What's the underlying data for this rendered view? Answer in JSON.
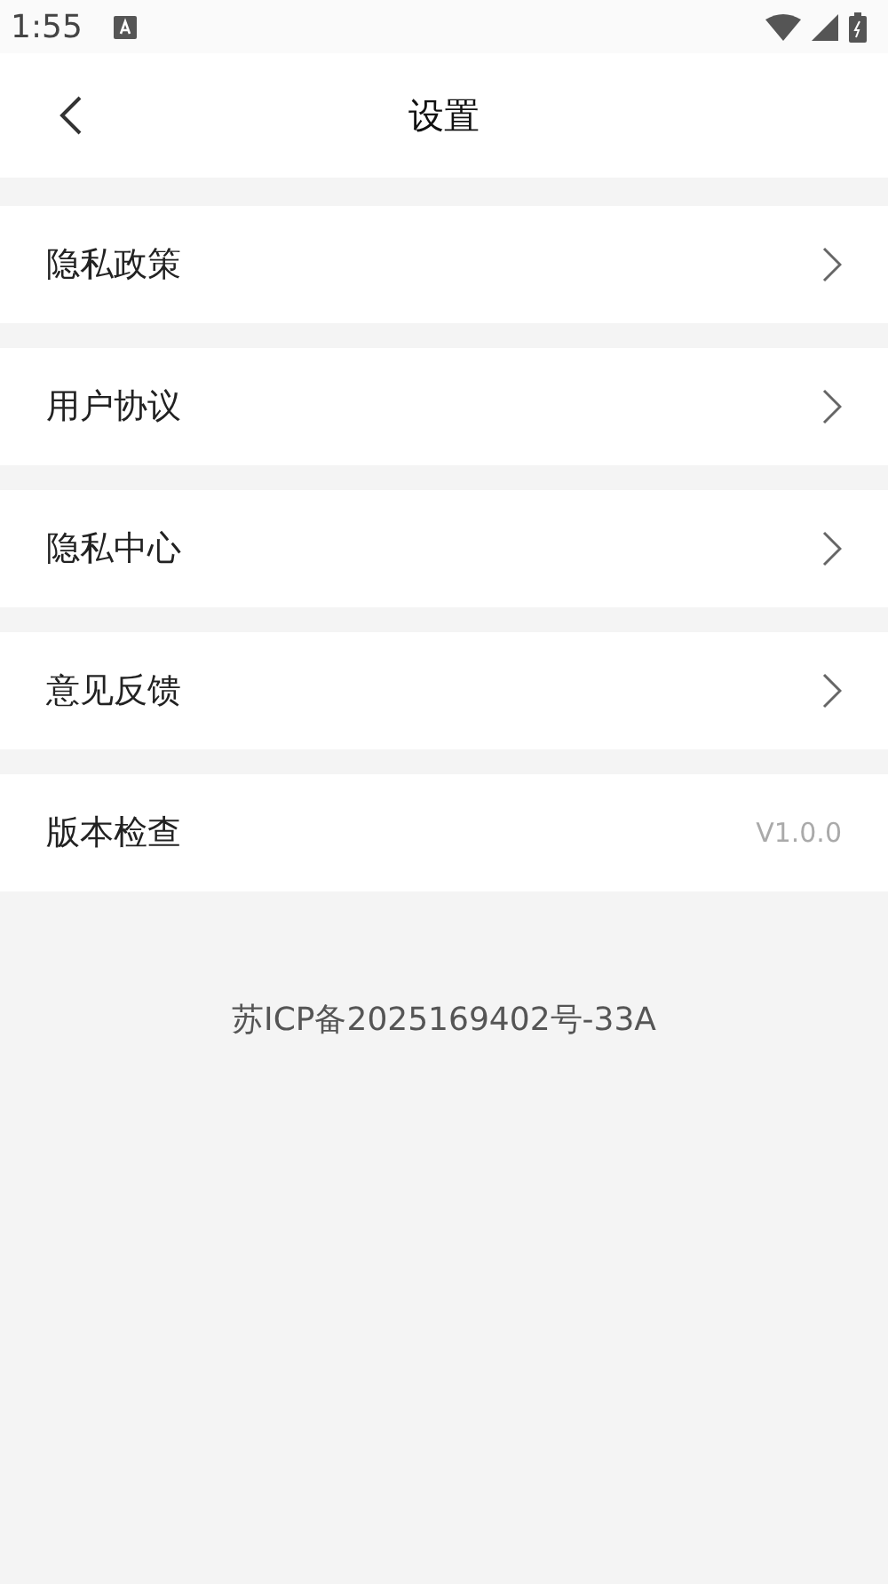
{
  "status_bar": {
    "time": "1:55"
  },
  "header": {
    "title": "设置"
  },
  "items": [
    {
      "kind": "link",
      "label": "隐私政策"
    },
    {
      "kind": "link",
      "label": "用户协议"
    },
    {
      "kind": "link",
      "label": "隐私中心"
    },
    {
      "kind": "link",
      "label": "意见反馈"
    },
    {
      "kind": "value",
      "label": "版本检查",
      "value": "V1.0.0"
    }
  ],
  "footer": {
    "text": "苏ICP备2025169402号-33A"
  }
}
